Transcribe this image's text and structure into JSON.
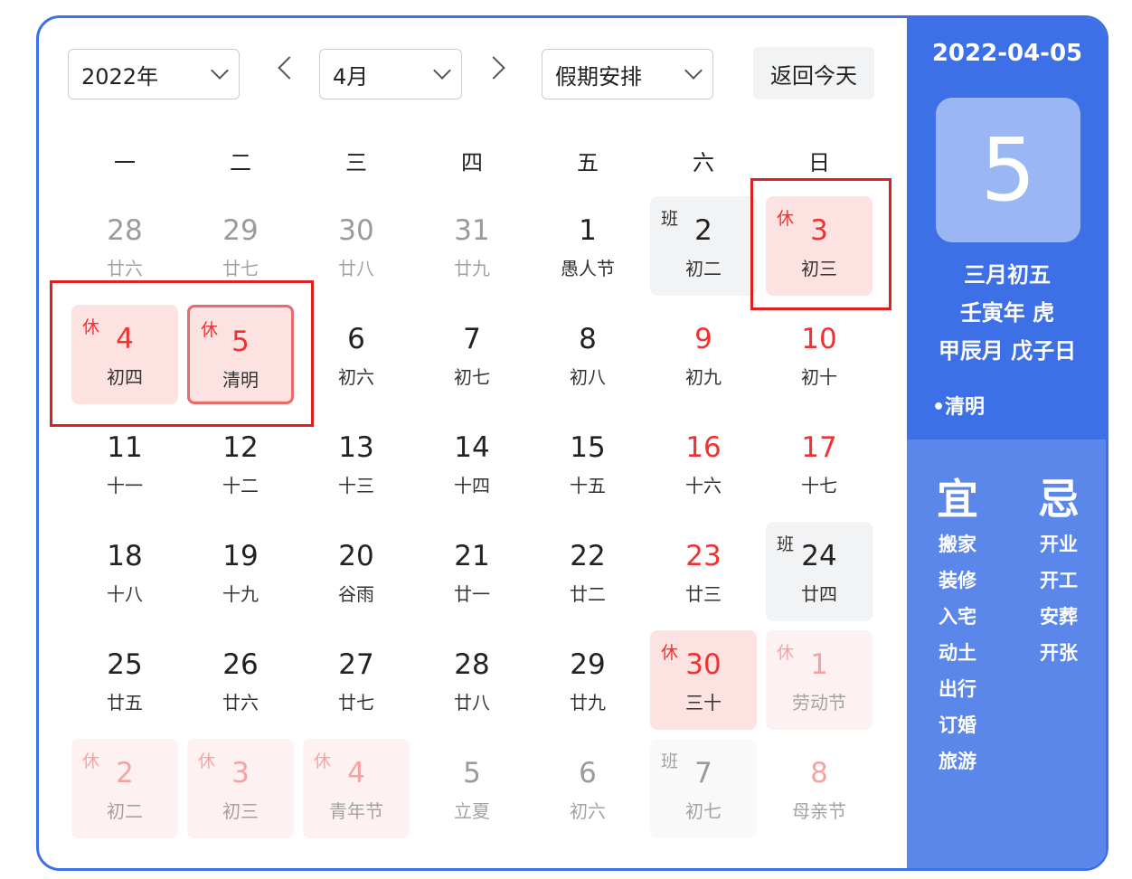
{
  "toolbar": {
    "year": "2022年",
    "month": "4月",
    "holiday": "假期安排",
    "today": "返回今天"
  },
  "weekdays": [
    "一",
    "二",
    "三",
    "四",
    "五",
    "六",
    "日"
  ],
  "days": [
    {
      "n": "28",
      "l": "廿六",
      "c": "other"
    },
    {
      "n": "29",
      "l": "廿七",
      "c": "other"
    },
    {
      "n": "30",
      "l": "廿八",
      "c": "other"
    },
    {
      "n": "31",
      "l": "廿九",
      "c": "other"
    },
    {
      "n": "1",
      "l": "愚人节",
      "c": ""
    },
    {
      "n": "2",
      "l": "初二",
      "c": "work",
      "t": "班"
    },
    {
      "n": "3",
      "l": "初三",
      "c": "rest red",
      "t": "休"
    },
    {
      "n": "4",
      "l": "初四",
      "c": "rest",
      "t": "休"
    },
    {
      "n": "5",
      "l": "清明",
      "c": "rest sel5",
      "t": "休"
    },
    {
      "n": "6",
      "l": "初六",
      "c": ""
    },
    {
      "n": "7",
      "l": "初七",
      "c": ""
    },
    {
      "n": "8",
      "l": "初八",
      "c": ""
    },
    {
      "n": "9",
      "l": "初九",
      "c": "red"
    },
    {
      "n": "10",
      "l": "初十",
      "c": "red"
    },
    {
      "n": "11",
      "l": "十一",
      "c": ""
    },
    {
      "n": "12",
      "l": "十二",
      "c": ""
    },
    {
      "n": "13",
      "l": "十三",
      "c": ""
    },
    {
      "n": "14",
      "l": "十四",
      "c": ""
    },
    {
      "n": "15",
      "l": "十五",
      "c": ""
    },
    {
      "n": "16",
      "l": "十六",
      "c": "red"
    },
    {
      "n": "17",
      "l": "十七",
      "c": "red"
    },
    {
      "n": "18",
      "l": "十八",
      "c": ""
    },
    {
      "n": "19",
      "l": "十九",
      "c": ""
    },
    {
      "n": "20",
      "l": "谷雨",
      "c": ""
    },
    {
      "n": "21",
      "l": "廿一",
      "c": ""
    },
    {
      "n": "22",
      "l": "廿二",
      "c": ""
    },
    {
      "n": "23",
      "l": "廿三",
      "c": "red"
    },
    {
      "n": "24",
      "l": "廿四",
      "c": "work",
      "t": "班"
    },
    {
      "n": "25",
      "l": "廿五",
      "c": ""
    },
    {
      "n": "26",
      "l": "廿六",
      "c": ""
    },
    {
      "n": "27",
      "l": "廿七",
      "c": ""
    },
    {
      "n": "28",
      "l": "廿八",
      "c": ""
    },
    {
      "n": "29",
      "l": "廿九",
      "c": ""
    },
    {
      "n": "30",
      "l": "三十",
      "c": "rest red",
      "t": "休"
    },
    {
      "n": "1",
      "l": "劳动节",
      "c": "rest other",
      "t": "休"
    },
    {
      "n": "2",
      "l": "初二",
      "c": "rest other",
      "t": "休"
    },
    {
      "n": "3",
      "l": "初三",
      "c": "rest other",
      "t": "休"
    },
    {
      "n": "4",
      "l": "青年节",
      "c": "rest other",
      "t": "休"
    },
    {
      "n": "5",
      "l": "立夏",
      "c": "other"
    },
    {
      "n": "6",
      "l": "初六",
      "c": "other"
    },
    {
      "n": "7",
      "l": "初七",
      "c": "work other",
      "t": "班"
    },
    {
      "n": "8",
      "l": "母亲节",
      "c": "red other"
    }
  ],
  "panel": {
    "date": "2022-04-05",
    "day": "5",
    "lunar": "三月初五",
    "year": "壬寅年 虎",
    "month_day": "甲辰月 戊子日",
    "festival": "•清明",
    "yi_title": "宜",
    "yi": [
      "搬家",
      "装修",
      "入宅",
      "动土",
      "出行",
      "订婚",
      "旅游"
    ],
    "ji_title": "忌",
    "ji": [
      "开业",
      "开工",
      "安葬",
      "开张"
    ]
  },
  "colors": {
    "accent": "#3d6fe6",
    "holiday_red": "#e33333",
    "rest_bg": "#fde2e2",
    "highlight_box": "#e02020"
  }
}
